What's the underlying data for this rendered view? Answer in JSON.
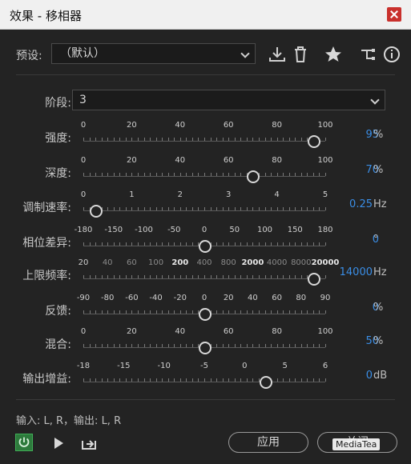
{
  "window": {
    "title": "效果 - 移相器",
    "close_icon": "close-icon"
  },
  "preset": {
    "label": "预设:",
    "value": "（默认）"
  },
  "toolbar": {
    "icons": [
      "download-icon",
      "trash-icon",
      "star-icon",
      "routing-icon",
      "info-icon"
    ]
  },
  "stage": {
    "label": "阶段:",
    "value": "3"
  },
  "sliders": [
    {
      "label": "强度:",
      "value": "95",
      "unit": "%",
      "ticks_min": 0,
      "ticks_max": 100,
      "tick_labels": [
        "0",
        "20",
        "40",
        "60",
        "80",
        "100"
      ],
      "position": 0.95
    },
    {
      "label": "深度:",
      "value": "70",
      "unit": "%",
      "tick_labels": [
        "0",
        "20",
        "40",
        "60",
        "80",
        "100"
      ],
      "position": 0.7
    },
    {
      "label": "调制速率:",
      "value": "0.25",
      "unit": "Hz",
      "tick_labels": [
        "0",
        "1",
        "2",
        "3",
        "4",
        "5"
      ],
      "position": 0.05
    },
    {
      "label": "相位差异:",
      "value": "0",
      "unit": "°",
      "tick_labels": [
        "-180",
        "-150",
        "-100",
        "-50",
        "0",
        "50",
        "100",
        "150",
        "180"
      ],
      "position": 0.5
    },
    {
      "label": "上限频率:",
      "value": "14000",
      "unit": "Hz",
      "tick_labels": [
        "20",
        "40",
        "60",
        "100",
        "200",
        "400",
        "800",
        "2000",
        "4000",
        "8000",
        "20000"
      ],
      "position": 0.95
    },
    {
      "label": "反馈:",
      "value": "0",
      "unit": "%",
      "tick_labels": [
        "-90",
        "-80",
        "-60",
        "-40",
        "-20",
        "0",
        "20",
        "40",
        "60",
        "80",
        "90"
      ],
      "position": 0.5
    },
    {
      "label": "混合:",
      "value": "50",
      "unit": "%",
      "tick_labels": [
        "0",
        "20",
        "40",
        "60",
        "80",
        "100"
      ],
      "position": 0.5
    },
    {
      "label": "输出增益:",
      "value": "0",
      "unit": "dB",
      "tick_labels": [
        "-18",
        "-15",
        "-10",
        "-5",
        "0",
        "5",
        "6"
      ],
      "position": 0.75
    }
  ],
  "io": {
    "text": "输入: L, R，输出: L, R"
  },
  "bottom": {
    "apply": "应用",
    "close": "关闭",
    "watermark": "MediaTea"
  },
  "colors": {
    "accent": "#3a8ee6",
    "power": "#2d7a3c"
  }
}
